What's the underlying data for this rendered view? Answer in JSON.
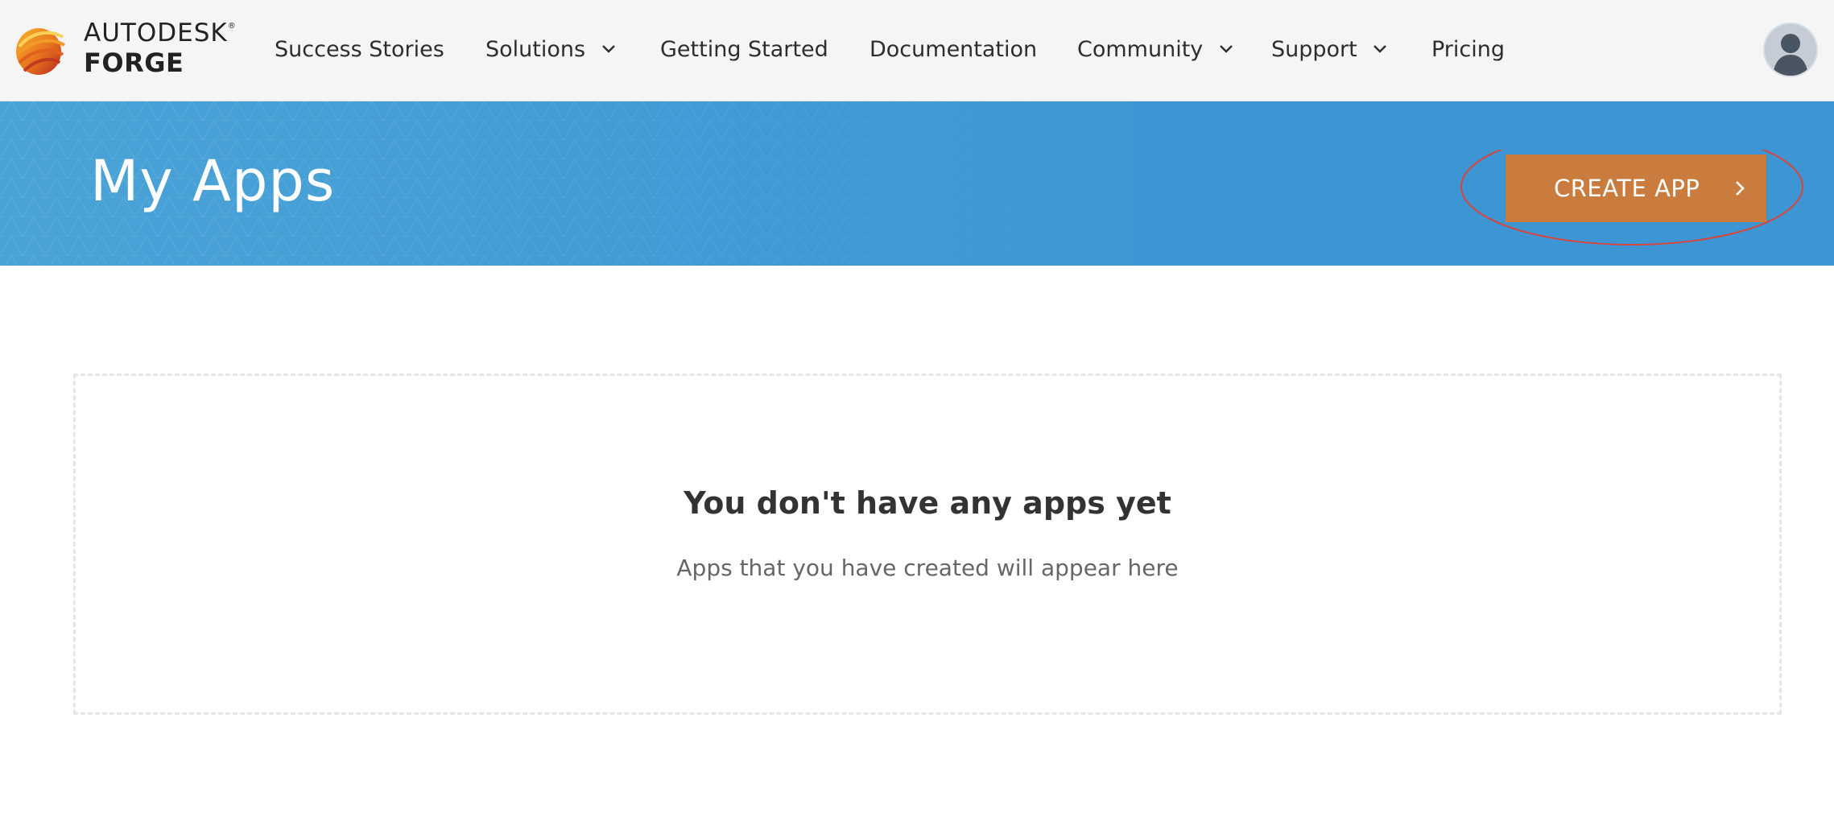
{
  "logo": {
    "line1": "AUTODESK",
    "reg": "®",
    "line2": "FORGE"
  },
  "nav": {
    "items": [
      {
        "label": "Success Stories",
        "dropdown": false
      },
      {
        "label": "Solutions",
        "dropdown": true
      },
      {
        "label": "Getting Started",
        "dropdown": false
      },
      {
        "label": "Documentation",
        "dropdown": false
      },
      {
        "label": "Community",
        "dropdown": true
      },
      {
        "label": "Support",
        "dropdown": true
      },
      {
        "label": "Pricing",
        "dropdown": false
      }
    ],
    "avatar_icon": "user-avatar-icon"
  },
  "banner": {
    "title": "My Apps",
    "create_button": "CREATE APP",
    "create_button_icon": "chevron-right-icon"
  },
  "empty_state": {
    "title": "You don't have any apps yet",
    "subtitle": "Apps that you have created will appear here"
  },
  "colors": {
    "banner_blue": "#3d95d3",
    "button_orange": "#c97c3e",
    "highlight_red": "#d9453a",
    "nav_bg": "#f5f5f5"
  }
}
